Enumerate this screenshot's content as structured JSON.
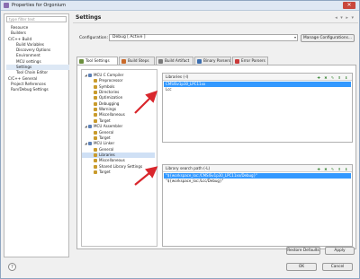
{
  "window": {
    "title": "Properties for Orgonium",
    "close_icon": "close-icon"
  },
  "left": {
    "filter_placeholder": "type filter text",
    "nav": [
      "Resource",
      "Builders",
      "C/C++ Build",
      "Build Variables",
      "Discovery Options",
      "Environment",
      "MCU settings",
      "Settings",
      "Tool Chain Editor",
      "C/C++ General",
      "Project References",
      "Run/Debug Settings"
    ]
  },
  "main": {
    "title": "Settings",
    "header_icons": "◂ ▾ ▸ ▾",
    "config_label": "Configuration:",
    "config_value": "Debug [ Active ]",
    "manage_button": "Manage Configurations...",
    "tabs": [
      {
        "label": "Tool Settings",
        "color": "#6b8e3d"
      },
      {
        "label": "Build Steps",
        "color": "#c96a2a"
      },
      {
        "label": "Build Artifact",
        "color": "#7a7a7a"
      },
      {
        "label": "Binary Parsers",
        "color": "#3d6fb0"
      },
      {
        "label": "Error Parsers",
        "color": "#c93a3a"
      }
    ],
    "tree": [
      {
        "label": "MCU C Compiler",
        "level": 0,
        "expand": "◢",
        "type": "category"
      },
      {
        "label": "Preprocessor",
        "level": 1,
        "type": "item"
      },
      {
        "label": "Symbols",
        "level": 1,
        "type": "item"
      },
      {
        "label": "Directories",
        "level": 1,
        "type": "item"
      },
      {
        "label": "Optimization",
        "level": 1,
        "type": "item"
      },
      {
        "label": "Debugging",
        "level": 1,
        "type": "item"
      },
      {
        "label": "Warnings",
        "level": 1,
        "type": "item"
      },
      {
        "label": "Miscellaneous",
        "level": 1,
        "type": "item"
      },
      {
        "label": "Target",
        "level": 1,
        "type": "item"
      },
      {
        "label": "MCU Assembler",
        "level": 0,
        "expand": "◢",
        "type": "category"
      },
      {
        "label": "General",
        "level": 1,
        "type": "item"
      },
      {
        "label": "Target",
        "level": 1,
        "type": "item"
      },
      {
        "label": "MCU Linker",
        "level": 0,
        "expand": "◢",
        "type": "category"
      },
      {
        "label": "General",
        "level": 1,
        "type": "item"
      },
      {
        "label": "Libraries",
        "level": 1,
        "type": "item",
        "selected": true
      },
      {
        "label": "Miscellaneous",
        "level": 1,
        "type": "item"
      },
      {
        "label": "Shared Library Settings",
        "level": 1,
        "type": "item"
      },
      {
        "label": "Target",
        "level": 1,
        "type": "item"
      }
    ],
    "libraries": {
      "header": "Libraries (-l)",
      "rows": [
        {
          "text": "CMSISv1p30_LPC11xx",
          "selected": true
        },
        {
          "text": "Lcc",
          "selected": false
        }
      ]
    },
    "search_path": {
      "header": "Library search path (-L)",
      "rows": [
        {
          "text": "\"${workspace_loc:/CMSISv1p30_LPC11xx/Debug}\"",
          "selected": true
        },
        {
          "text": "\"${workspace_loc:/Lcc/Debug}\"",
          "selected": false
        }
      ]
    },
    "list_actions": "✚ ✖ ✎ ⬆ ⬇",
    "restore_button": "Restore Defaults",
    "apply_button": "Apply"
  },
  "footer": {
    "ok_button": "OK",
    "cancel_button": "Cancel",
    "help_label": "?"
  },
  "colors": {
    "selection": "#3399ff",
    "arrow": "#d9262c"
  }
}
